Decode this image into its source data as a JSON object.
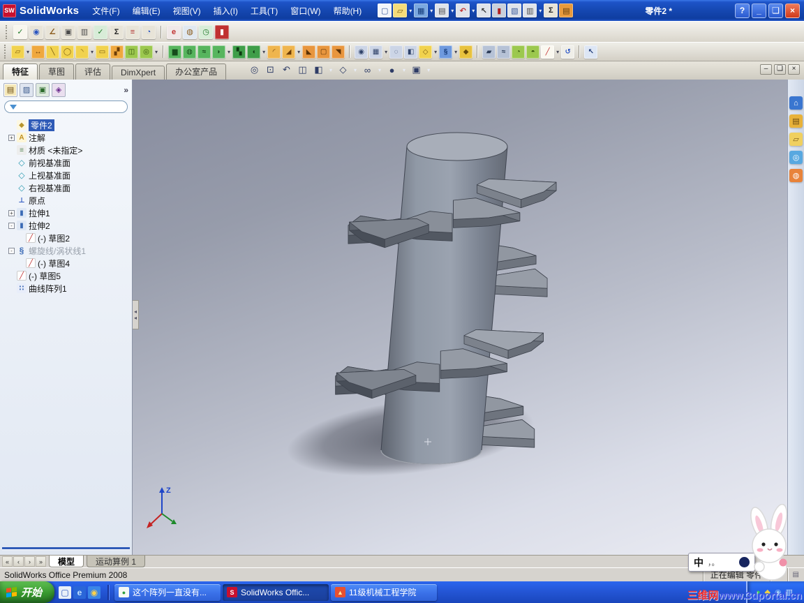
{
  "titlebar": {
    "logo_badge": "SW",
    "logo_text": "SolidWorks",
    "doc_title": "零件2 *",
    "help_label": "?",
    "menus": [
      "文件(F)",
      "编辑(E)",
      "视图(V)",
      "插入(I)",
      "工具(T)",
      "窗口(W)",
      "帮助(H)"
    ],
    "std_icons": [
      {
        "name": "new-document",
        "glyph": "▢",
        "bg": "#f2f5fa",
        "fg": "#3a5a9c"
      },
      {
        "name": "open-document",
        "glyph": "▱",
        "bg": "#f5dc7a",
        "fg": "#7a5a10",
        "caret": true
      },
      {
        "name": "save",
        "glyph": "▦",
        "bg": "#7aa8e0",
        "fg": "#123a7a",
        "caret": true
      },
      {
        "name": "print",
        "glyph": "▤",
        "bg": "#dfe3ea",
        "fg": "#4a4a4a",
        "caret": true
      },
      {
        "name": "undo",
        "glyph": "↶",
        "bg": "#dfe3ea",
        "fg": "#c03030",
        "caret": true
      },
      {
        "name": "select",
        "glyph": "↖",
        "bg": "#dfe3ea",
        "fg": "#333333"
      },
      {
        "name": "rebuild",
        "glyph": "▮",
        "bg": "#c8d0dc",
        "fg": "#b02020"
      },
      {
        "name": "file-properties",
        "glyph": "▧",
        "bg": "#dfe3ea",
        "fg": "#3a5a9c"
      },
      {
        "name": "options",
        "glyph": "▥",
        "bg": "#dfe3ea",
        "fg": "#4a4a4a",
        "caret": true
      },
      {
        "name": "sigma",
        "glyph": "Σ",
        "bg": "#e8e4d8",
        "fg": "#222222"
      },
      {
        "name": "toolbox",
        "glyph": "▤",
        "bg": "#e89a3c",
        "fg": "#5f3a0a"
      }
    ],
    "window_controls": [
      {
        "name": "minimize",
        "glyph": "_"
      },
      {
        "name": "maximize",
        "glyph": "❏"
      },
      {
        "name": "close",
        "glyph": "×"
      }
    ]
  },
  "toolbar2_icons": [
    {
      "name": "spell-check",
      "glyph": "✓",
      "bg": "#f8f6ee",
      "fg": "#1f7a2a"
    },
    {
      "name": "hyperlink",
      "glyph": "◉",
      "bg": "#e8e4d8",
      "fg": "#2a55c0"
    },
    {
      "name": "measure",
      "glyph": "∠",
      "bg": "#e8e4d8",
      "fg": "#8a5a1a"
    },
    {
      "name": "mass-properties",
      "glyph": "▣",
      "bg": "#e8e4d8",
      "fg": "#4a4a4a"
    },
    {
      "name": "section-properties",
      "glyph": "▥",
      "bg": "#e8e4d8",
      "fg": "#4a4a4a"
    },
    {
      "name": "check-geometry",
      "glyph": "✓",
      "bg": "#d8ecd8",
      "fg": "#1f7a2a"
    },
    {
      "name": "statistics",
      "glyph": "Σ",
      "bg": "#e8e4d8",
      "fg": "#222222"
    },
    {
      "name": "equations",
      "glyph": "≡",
      "bg": "#e8e4d8",
      "fg": "#b03030"
    },
    {
      "name": "deviation-analysis",
      "glyph": "◔",
      "bg": "#e8e4d8",
      "fg": "#2a55c0"
    },
    {
      "sep": true
    },
    {
      "name": "edrawings",
      "glyph": "e",
      "bg": "#f0e8e8",
      "fg": "#c03030"
    },
    {
      "name": "photoworks",
      "glyph": "◍",
      "bg": "#e0e8f0",
      "fg": "#8a5a1a"
    },
    {
      "name": "task-scheduler",
      "glyph": "◷",
      "bg": "#d8ecd8",
      "fg": "#1f7a2a"
    },
    {
      "name": "edrawings-publish",
      "glyph": "▮",
      "bg": "#c03030",
      "fg": "#ffffff"
    }
  ],
  "toolbar3_icons": [
    {
      "name": "sketch",
      "glyph": "▱",
      "bg": "#f1d24e",
      "fg": "#7a5c10",
      "caret": true
    },
    {
      "name": "smart-dimension",
      "glyph": "↔",
      "bg": "#efa83e",
      "fg": "#6b3c08"
    },
    {
      "name": "line",
      "glyph": "╲",
      "bg": "#f1d24e",
      "fg": "#7a5c10"
    },
    {
      "name": "circle",
      "glyph": "◯",
      "bg": "#f1d24e",
      "fg": "#7a5c10"
    },
    {
      "name": "arc",
      "glyph": "◝",
      "bg": "#f1d24e",
      "fg": "#7a5c10",
      "caret": true
    },
    {
      "name": "rectangle",
      "glyph": "▭",
      "bg": "#f1d24e",
      "fg": "#7a5c10"
    },
    {
      "name": "trim-entities",
      "glyph": "▞",
      "bg": "#efa83e",
      "fg": "#6b3c08"
    },
    {
      "name": "convert-entities",
      "glyph": "◫",
      "bg": "#9cc84e",
      "fg": "#33540a"
    },
    {
      "name": "offset-entities",
      "glyph": "◎",
      "bg": "#9cc84e",
      "fg": "#33540a",
      "caret": true
    },
    {
      "sep": true
    },
    {
      "name": "extruded-boss",
      "glyph": "▆",
      "bg": "#57b55e",
      "fg": "#164b1b"
    },
    {
      "name": "revolved-boss",
      "glyph": "◍",
      "bg": "#57b55e",
      "fg": "#164b1b"
    },
    {
      "name": "swept-boss",
      "glyph": "≈",
      "bg": "#57b55e",
      "fg": "#164b1b"
    },
    {
      "name": "lofted-boss",
      "glyph": "◗",
      "bg": "#57b55e",
      "fg": "#164b1b",
      "caret": true
    },
    {
      "name": "extruded-cut",
      "glyph": "▚",
      "bg": "#3f9e49",
      "fg": "#0e3a12"
    },
    {
      "name": "revolved-cut",
      "glyph": "◖",
      "bg": "#3f9e49",
      "fg": "#0e3a12",
      "caret": true
    },
    {
      "name": "fillet",
      "glyph": "◜",
      "bg": "#efb54e",
      "fg": "#6b3c08"
    },
    {
      "name": "chamfer",
      "glyph": "◢",
      "bg": "#efb54e",
      "fg": "#6b3c08",
      "caret": true
    },
    {
      "name": "rib",
      "glyph": "◣",
      "bg": "#e8963e",
      "fg": "#5c3206"
    },
    {
      "name": "shell",
      "glyph": "▢",
      "bg": "#e8963e",
      "fg": "#5c3206"
    },
    {
      "name": "draft",
      "glyph": "◥",
      "bg": "#e8963e",
      "fg": "#5c3206"
    },
    {
      "sep": true
    },
    {
      "name": "hole-wizard",
      "glyph": "◉",
      "bg": "#ccd5e6",
      "fg": "#2e4168"
    },
    {
      "name": "linear-pattern",
      "glyph": "▦",
      "bg": "#ccd5e6",
      "fg": "#2e4168",
      "caret": true
    },
    {
      "name": "circular-pattern",
      "glyph": "◌",
      "bg": "#ccd5e6",
      "fg": "#2e4168"
    },
    {
      "name": "mirror-feature",
      "glyph": "◧",
      "bg": "#ccd5e6",
      "fg": "#2e4168"
    },
    {
      "name": "reference-geometry",
      "glyph": "◇",
      "bg": "#f1d24e",
      "fg": "#7a5c10",
      "caret": true
    },
    {
      "name": "curves",
      "glyph": "§",
      "bg": "#6f9ade",
      "fg": "#0f3472",
      "caret": true
    },
    {
      "name": "instant3d",
      "glyph": "◆",
      "bg": "#e8c23e",
      "fg": "#63480a"
    },
    {
      "sep": true
    },
    {
      "name": "move-face",
      "glyph": "▰",
      "bg": "#b6c2d6",
      "fg": "#2c3c58"
    },
    {
      "name": "flex",
      "glyph": "≈",
      "bg": "#b6c2d6",
      "fg": "#2c3c58"
    },
    {
      "name": "wrap",
      "glyph": "◔",
      "bg": "#9cc84e",
      "fg": "#33540a"
    },
    {
      "name": "dome",
      "glyph": "◓",
      "bg": "#9cc84e",
      "fg": "#33540a"
    },
    {
      "name": "edit-sketch",
      "glyph": "╱",
      "bg": "#faf8f0",
      "fg": "#c23030",
      "caret": true
    },
    {
      "name": "undo-last",
      "glyph": "↺",
      "bg": "#efeee8",
      "fg": "#2a55c8"
    },
    {
      "sep": true
    },
    {
      "name": "select-arrow",
      "glyph": "↖",
      "bg": "#dde6f4",
      "fg": "#1e3a78"
    }
  ],
  "command_tabs": {
    "active": "特征",
    "items": [
      "特征",
      "草图",
      "评估",
      "DimXpert",
      "办公室产品"
    ]
  },
  "headsup_icons": [
    {
      "name": "zoom-to-fit",
      "glyph": "◎"
    },
    {
      "name": "zoom-to-area",
      "glyph": "⊡"
    },
    {
      "name": "previous-view",
      "glyph": "↶"
    },
    {
      "name": "section-view",
      "glyph": "◫"
    },
    {
      "name": "view-orientation",
      "glyph": "◧",
      "caret": true
    },
    {
      "name": "display-style",
      "glyph": "◇",
      "caret": true
    },
    {
      "name": "hide-show-items",
      "glyph": "∞",
      "caret": true
    },
    {
      "name": "edit-appearance",
      "glyph": "●",
      "caret": true
    },
    {
      "name": "apply-scene",
      "glyph": "▣",
      "caret": true
    }
  ],
  "panel": {
    "chevron": "»",
    "filter_placeholder": "",
    "tab_icons": [
      {
        "name": "featuremanager-tree",
        "glyph": "▤",
        "bg": "#f5e8b8",
        "fg": "#6a4a10"
      },
      {
        "name": "property-manager",
        "glyph": "▨",
        "bg": "#dfe5f0",
        "fg": "#3a5a8c"
      },
      {
        "name": "configuration-manager",
        "glyph": "▣",
        "bg": "#dfeadf",
        "fg": "#2a6a2a"
      },
      {
        "name": "dimxpert-manager",
        "glyph": "◈",
        "bg": "#eadfef",
        "fg": "#6a2a8c"
      }
    ]
  },
  "tree": {
    "root": "零件2",
    "items": [
      {
        "label": "注解",
        "icon": "annotations",
        "glyph": "A",
        "exp": "+"
      },
      {
        "label": "材质 <未指定>",
        "icon": "material",
        "glyph": "≡"
      },
      {
        "label": "前视基准面",
        "icon": "plane",
        "glyph": "◇"
      },
      {
        "label": "上视基准面",
        "icon": "plane",
        "glyph": "◇"
      },
      {
        "label": "右视基准面",
        "icon": "plane",
        "glyph": "◇"
      },
      {
        "label": "原点",
        "icon": "origin",
        "glyph": "⊥"
      },
      {
        "label": "拉伸1",
        "icon": "extrude",
        "glyph": "▮",
        "exp": "+"
      },
      {
        "label": "拉伸2",
        "icon": "extrude",
        "glyph": "▮",
        "exp": "-"
      },
      {
        "label": "(-) 草图2",
        "icon": "sketch",
        "glyph": "╱",
        "indent": 1
      },
      {
        "label": "螺旋线/涡状线1",
        "icon": "helix",
        "glyph": "§",
        "exp": "-",
        "dim": true
      },
      {
        "label": "(-) 草图4",
        "icon": "sketch",
        "glyph": "╱",
        "indent": 1
      },
      {
        "label": "(-) 草图5",
        "icon": "sketch",
        "glyph": "╱"
      },
      {
        "label": "曲线阵列1",
        "icon": "curve-pattern",
        "glyph": "∷"
      }
    ]
  },
  "taskpane_icons": [
    {
      "name": "solidworks-resources",
      "glyph": "⌂",
      "bg": "#3a76d0",
      "fg": "#ffffff"
    },
    {
      "name": "design-library",
      "glyph": "▤",
      "bg": "#e8b23a",
      "fg": "#6a4a10"
    },
    {
      "name": "file-explorer",
      "glyph": "▱",
      "bg": "#f0d060",
      "fg": "#7a5a18"
    },
    {
      "name": "search",
      "glyph": "◎",
      "bg": "#58a8e0",
      "fg": "#ffffff"
    },
    {
      "name": "view-palette",
      "glyph": "◍",
      "bg": "#e8833a",
      "fg": "#ffffff"
    }
  ],
  "doc_tabs": {
    "nav": [
      "«",
      "‹",
      "›",
      "»"
    ],
    "items": [
      "模型",
      "运动算例 1"
    ],
    "active": "模型"
  },
  "status": {
    "left": "SolidWorks Office Premium 2008",
    "editing": "正在编辑 零件",
    "grid_icons": [
      "▦",
      "▤"
    ]
  },
  "taskbar": {
    "start": "开始",
    "quick_launch": [
      {
        "name": "show-desktop",
        "glyph": "▢",
        "bg": "#e8f0f8",
        "fg": "#2a55c0"
      },
      {
        "name": "internet-explorer",
        "glyph": "e",
        "bg": "#2a66d8",
        "fg": "#bfe0ff"
      },
      {
        "name": "media-player",
        "glyph": "◉",
        "bg": "#3a86e8",
        "fg": "#ffd24a"
      }
    ],
    "tasks": [
      {
        "name": "task-browser-window",
        "label": "这个阵列一直没有...",
        "glyph": "●",
        "ibg": "#f4f8f4",
        "ifg": "#2f9e3f",
        "active": false
      },
      {
        "name": "task-solidworks",
        "label": "SolidWorks Offic...",
        "glyph": "S",
        "ibg": "#c8102e",
        "ifg": "#ffffff",
        "active": true
      },
      {
        "name": "task-school-site",
        "label": "11级机械工程学院",
        "glyph": "▲",
        "ibg": "#e85030",
        "ifg": "#ffe8a0",
        "active": false
      }
    ],
    "tray_icons": [
      {
        "name": "tray-antivirus",
        "glyph": "●",
        "fg": "#3fd05a"
      },
      {
        "name": "tray-messenger",
        "glyph": "◆",
        "fg": "#f0d040"
      },
      {
        "name": "tray-volume",
        "glyph": "◉",
        "fg": "#9ac8f8"
      },
      {
        "name": "tray-network",
        "glyph": "▥",
        "fg": "#c8e0f8"
      }
    ]
  },
  "overlay": {
    "watermark_cn": "三维网",
    "watermark_url": "www.3dportal.cn",
    "lang": "中",
    "lang_marks": "，。",
    "triad_z": "Z"
  }
}
